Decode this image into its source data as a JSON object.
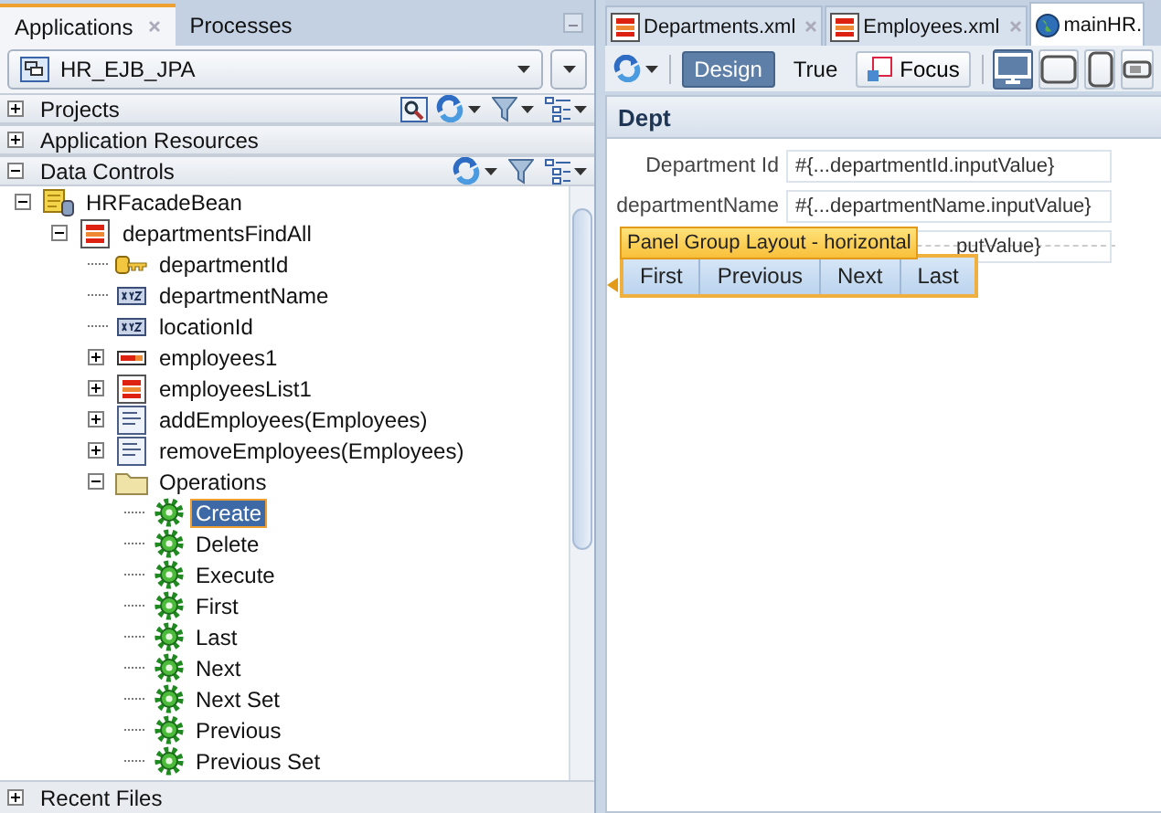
{
  "left_panel": {
    "tabs": [
      {
        "label": "Applications",
        "selected": true,
        "closable": true
      },
      {
        "label": "Processes",
        "selected": false,
        "closable": false
      }
    ],
    "application_selector": {
      "value": "HR_EJB_JPA"
    },
    "sections": [
      {
        "title": "Projects",
        "expanded": false
      },
      {
        "title": "Application Resources",
        "expanded": false
      },
      {
        "title": "Data Controls",
        "expanded": true
      }
    ],
    "tree": [
      {
        "label": "HRFacadeBean",
        "kind": "bean",
        "expanded": true,
        "selected": false,
        "children": [
          {
            "label": "departmentsFindAll",
            "kind": "collection",
            "expanded": true,
            "selected": false,
            "children": [
              {
                "label": "departmentId",
                "kind": "key",
                "selected": false
              },
              {
                "label": "departmentName",
                "kind": "attribute",
                "selected": false
              },
              {
                "label": "locationId",
                "kind": "attribute",
                "selected": false
              },
              {
                "label": "employees1",
                "kind": "accessor",
                "expanded": false,
                "selected": false
              },
              {
                "label": "employeesList1",
                "kind": "collection",
                "expanded": false,
                "selected": false
              },
              {
                "label": "addEmployees(Employees)",
                "kind": "method",
                "expanded": false,
                "selected": false
              },
              {
                "label": "removeEmployees(Employees)",
                "kind": "method",
                "expanded": false,
                "selected": false
              },
              {
                "label": "Operations",
                "kind": "folder",
                "expanded": true,
                "selected": false,
                "children": [
                  {
                    "label": "Create",
                    "kind": "operation",
                    "selected": true
                  },
                  {
                    "label": "Delete",
                    "kind": "operation",
                    "selected": false
                  },
                  {
                    "label": "Execute",
                    "kind": "operation",
                    "selected": false
                  },
                  {
                    "label": "First",
                    "kind": "operation",
                    "selected": false
                  },
                  {
                    "label": "Last",
                    "kind": "operation",
                    "selected": false
                  },
                  {
                    "label": "Next",
                    "kind": "operation",
                    "selected": false
                  },
                  {
                    "label": "Next Set",
                    "kind": "operation",
                    "selected": false
                  },
                  {
                    "label": "Previous",
                    "kind": "operation",
                    "selected": false
                  },
                  {
                    "label": "Previous Set",
                    "kind": "operation",
                    "selected": false
                  }
                ]
              }
            ]
          }
        ]
      }
    ],
    "bottom_section": {
      "title": "Recent Files",
      "expanded": false
    }
  },
  "editor": {
    "tabs": [
      {
        "label": "Departments.xml",
        "kind": "data",
        "selected": false,
        "closable": true
      },
      {
        "label": "Employees.xml",
        "kind": "data",
        "selected": false,
        "closable": true
      },
      {
        "label": "mainHR.",
        "kind": "page",
        "selected": true,
        "closable": false
      }
    ],
    "toolbar": {
      "modes": [
        {
          "label": "Design",
          "selected": true
        },
        {
          "label": "True",
          "selected": false
        }
      ],
      "focus_button": "Focus",
      "devices": [
        {
          "kind": "desktop",
          "selected": true
        },
        {
          "kind": "tablet-landscape",
          "selected": false
        },
        {
          "kind": "tablet-portrait",
          "selected": false
        },
        {
          "kind": "phone",
          "selected": false
        }
      ]
    },
    "panel": {
      "title": "Dept",
      "fields": [
        {
          "label": "Department Id",
          "value": "#{...departmentId.inputValue}"
        },
        {
          "label": "departmentName",
          "value": "#{...departmentName.inputValue}"
        },
        {
          "value": "putValue}"
        }
      ],
      "overlay_label": "Panel Group Layout - horizontal",
      "buttons": [
        "First",
        "Previous",
        "Next",
        "Last"
      ]
    }
  }
}
